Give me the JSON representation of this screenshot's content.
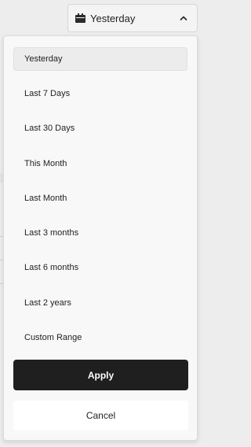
{
  "trigger": {
    "label": "Yesterday",
    "icon": "calendar-icon",
    "chevron": "chevron-up-icon"
  },
  "options": [
    {
      "label": "Yesterday",
      "selected": true
    },
    {
      "label": "Last 7 Days",
      "selected": false
    },
    {
      "label": "Last 30 Days",
      "selected": false
    },
    {
      "label": "This Month",
      "selected": false
    },
    {
      "label": "Last Month",
      "selected": false
    },
    {
      "label": "Last 3 months",
      "selected": false
    },
    {
      "label": "Last 6 months",
      "selected": false
    },
    {
      "label": "Last 2 years",
      "selected": false
    },
    {
      "label": "Custom Range",
      "selected": false
    }
  ],
  "actions": {
    "apply_label": "Apply",
    "cancel_label": "Cancel"
  },
  "colors": {
    "apply_bg": "#1f1f1f",
    "selected_bg": "#ececec"
  }
}
